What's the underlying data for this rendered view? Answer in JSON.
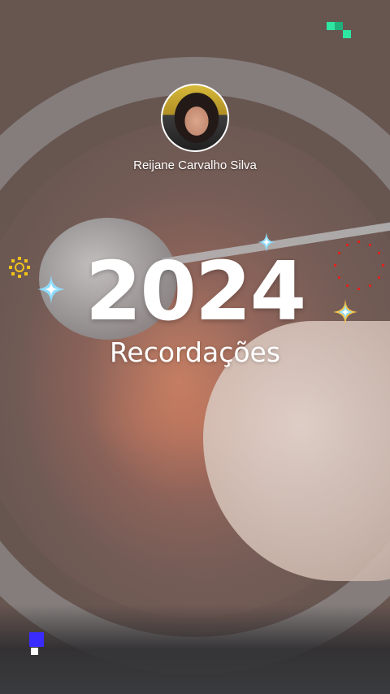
{
  "profile": {
    "name": "Reijane Carvalho Silva"
  },
  "recap": {
    "year": "2024",
    "subtitle": "Recordações"
  },
  "colors": {
    "text": "#ffffff",
    "sparkle_blue": "#6fd0ff",
    "sparkle_gold": "#f6c343",
    "sun_yellow": "#f2c21b",
    "ring_red": "#e0211b",
    "pixel_green": "#2ee6a1",
    "pixel_blue": "#3a2bff"
  },
  "icons": {
    "sparkles": "sparkle-icon",
    "sun": "sun-icon",
    "ring": "dotted-circle-icon",
    "pixels": "pixel-block-icon"
  }
}
